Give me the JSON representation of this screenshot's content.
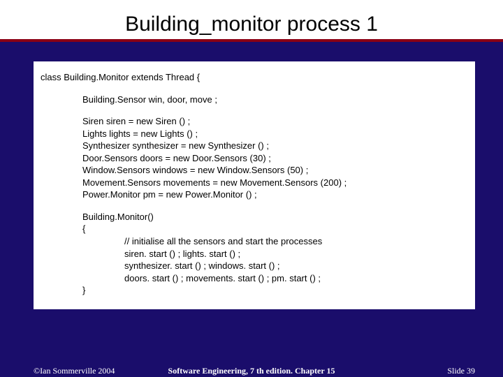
{
  "title": "Building_monitor process 1",
  "code": {
    "decl": "class Building.Monitor extends Thread {",
    "sensor": "Building.Sensor win, door, move ;",
    "init": [
      "Siren           siren = new Siren () ;",
      "Lights          lights = new Lights () ;",
      "Synthesizer synthesizer = new Synthesizer () ;",
      "Door.Sensors doors = new Door.Sensors (30) ;",
      "Window.Sensors         windows = new Window.Sensors (50) ;",
      "Movement.Sensors movements = new Movement.Sensors (200) ;",
      "Power.Monitor pm = new Power.Monitor () ;"
    ],
    "ctor_head": "Building.Monitor()",
    "ctor_open": "{",
    "ctor_body": [
      "// initialise all the sensors and start the processes",
      "siren. start () ; lights. start () ;",
      "synthesizer. start () ; windows. start () ;",
      "doors. start () ; movements. start () ; pm. start () ;"
    ],
    "ctor_close": "}"
  },
  "footer": {
    "left": "©Ian Sommerville 2004",
    "center": "Software Engineering, 7 th edition. Chapter 15",
    "right": "Slide  39"
  }
}
